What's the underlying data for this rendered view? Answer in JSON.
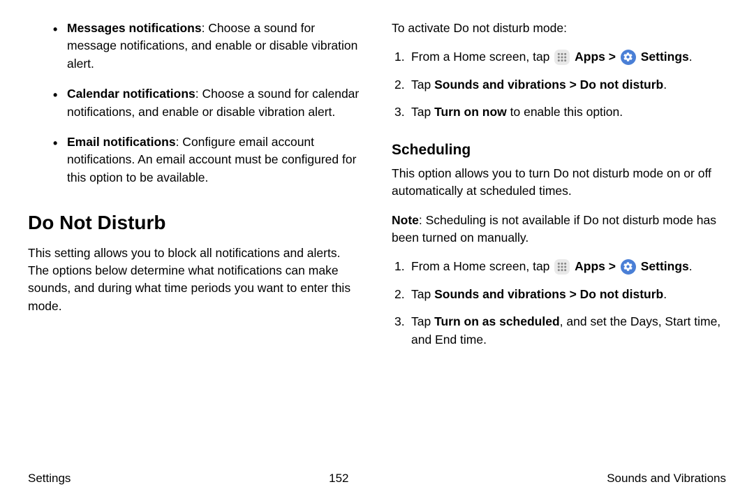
{
  "left": {
    "bullets": [
      {
        "label": "Messages notifications",
        "text": ": Choose a sound for message notifications, and enable or disable vibration alert."
      },
      {
        "label": "Calendar notifications",
        "text": ": Choose a sound for calendar notifications, and enable or disable vibration alert."
      },
      {
        "label": "Email notifications",
        "text": ": Configure email account notifications. An email account must be configured for this option to be available."
      }
    ],
    "heading": "Do Not Disturb",
    "para": "This setting allows you to block all notifications and alerts. The options below determine what notifications can make sounds, and during what time periods you want to enter this mode."
  },
  "right": {
    "intro": "To activate Do not disturb mode:",
    "steps1": {
      "s1a": "From a Home screen, tap ",
      "apps": "Apps",
      "gt": " > ",
      "settings": "Settings",
      "s1b": ".",
      "s2a": "Tap ",
      "s2b": "Sounds and vibrations > Do not disturb",
      "s2c": ".",
      "s3a": "Tap ",
      "s3b": "Turn on now",
      "s3c": " to enable this option."
    },
    "subheading": "Scheduling",
    "schedPara": "This option allows you to turn Do not disturb mode on or off automatically at scheduled times.",
    "noteLabel": "Note",
    "noteText": ": Scheduling is not available if Do not disturb mode has been turned on manually.",
    "steps2": {
      "s1a": "From a Home screen, tap ",
      "apps": "Apps",
      "gt": " > ",
      "settings": "Settings",
      "s1b": ".",
      "s2a": "Tap ",
      "s2b": "Sounds and vibrations > Do not disturb",
      "s2c": ".",
      "s3a": "Tap ",
      "s3b": "Turn on as scheduled",
      "s3c": ", and set the Days, Start time, and End time."
    }
  },
  "footer": {
    "left": "Settings",
    "center": "152",
    "right": "Sounds and Vibrations"
  }
}
